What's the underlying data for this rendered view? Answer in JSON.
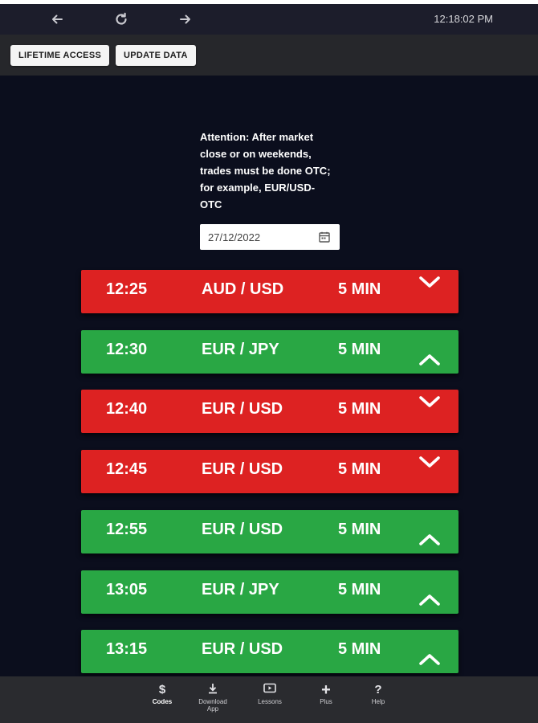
{
  "browser": {
    "clock": "12:18:02 PM"
  },
  "toolbar": {
    "lifetime_label": "LIFETIME ACCESS",
    "update_label": "UPDATE DATA"
  },
  "notice": {
    "text": "Attention: After market close or on weekends, trades must be done OTC; for example, EUR/USD-OTC"
  },
  "date_field": {
    "value": "27/12/2022"
  },
  "signals": [
    {
      "time": "12:25",
      "pair": "AUD / USD",
      "expiry": "5 MIN",
      "direction": "down"
    },
    {
      "time": "12:30",
      "pair": "EUR / JPY",
      "expiry": "5 MIN",
      "direction": "up"
    },
    {
      "time": "12:40",
      "pair": "EUR / USD",
      "expiry": "5 MIN",
      "direction": "down"
    },
    {
      "time": "12:45",
      "pair": "EUR / USD",
      "expiry": "5 MIN",
      "direction": "down"
    },
    {
      "time": "12:55",
      "pair": "EUR / USD",
      "expiry": "5 MIN",
      "direction": "up"
    },
    {
      "time": "13:05",
      "pair": "EUR / JPY",
      "expiry": "5 MIN",
      "direction": "up"
    },
    {
      "time": "13:15",
      "pair": "EUR / USD",
      "expiry": "5 MIN",
      "direction": "up"
    }
  ],
  "colors": {
    "down": "#dd2222",
    "up": "#29a744",
    "background": "#0b0e1d"
  },
  "bottom_nav": {
    "codes_icon": "$",
    "codes_label": "Codes",
    "download_label_1": "Download",
    "download_label_2": "App",
    "lessons_label": "Lessons",
    "plus_icon": "+",
    "plus_label": "Plus",
    "help_icon": "?",
    "help_label": "Help"
  }
}
